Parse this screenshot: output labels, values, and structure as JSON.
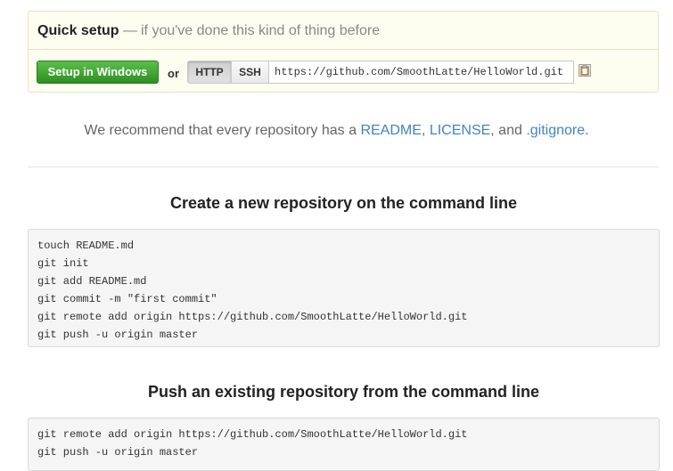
{
  "quick_setup": {
    "title": "Quick setup",
    "subtitle_dash": "—",
    "subtitle": "if you've done this kind of thing before",
    "setup_button": "Setup in Windows",
    "or_label": "or",
    "protocols": [
      "HTTP",
      "SSH"
    ],
    "selected_protocol": "HTTP",
    "clone_url": "https://github.com/SmoothLatte/HelloWorld.git",
    "clipboard_icon": "clipboard-icon"
  },
  "recommend": {
    "prefix": "We recommend that every repository has a",
    "readme": "README",
    "comma1": ",",
    "license": "LICENSE",
    "and": ", and",
    "gitignore": ".gitignore",
    "end": "."
  },
  "sections": [
    {
      "heading": "Create a new repository on the command line",
      "lines": [
        "touch README.md",
        "git init",
        "git add README.md",
        "git commit -m \"first commit\"",
        "git remote add origin https://github.com/SmoothLatte/HelloWorld.git",
        "git push -u origin master"
      ]
    },
    {
      "heading": "Push an existing repository from the command line",
      "lines": [
        "git remote add origin https://github.com/SmoothLatte/HelloWorld.git",
        "git push -u origin master"
      ]
    }
  ],
  "colors": {
    "accent_green": "#2e8f20",
    "link_blue": "#4183c4"
  }
}
